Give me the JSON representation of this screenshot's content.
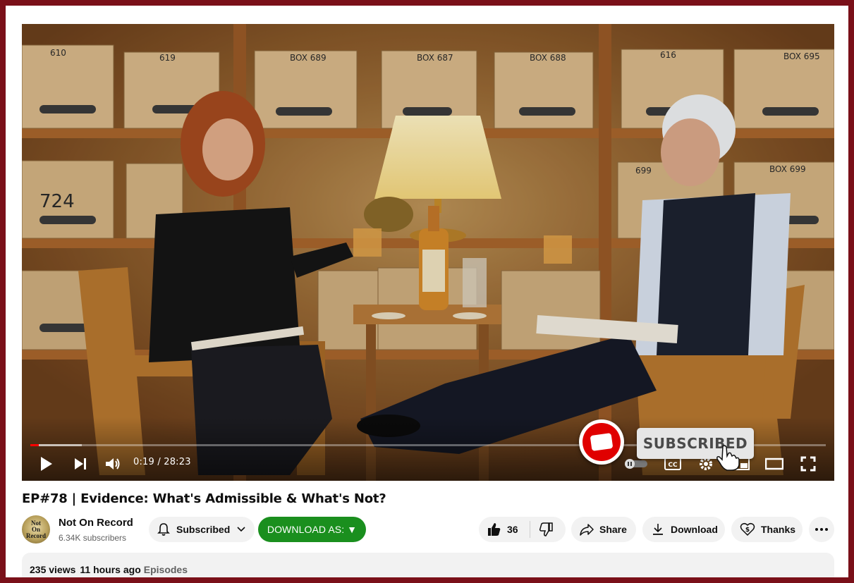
{
  "player": {
    "time_display": "0:19 / 28:23",
    "progress_fraction": 0.011,
    "buffered_fraction": 0.065,
    "overlay_subscribed_text": "SUBSCRIBED",
    "scene_box_labels": [
      "610",
      "619",
      "BOX 689",
      "BOX 687",
      "BOX 688",
      "616",
      "BOX 695",
      "724",
      "699",
      "BOX 699"
    ]
  },
  "video": {
    "title": "EP#78 | Evidence: What's Admissible & What's Not?"
  },
  "channel": {
    "avatar_text": [
      "Not",
      "On",
      "Record"
    ],
    "name": "Not On Record",
    "subscribers": "6.34K subscribers"
  },
  "actions": {
    "subscribed_label": "Subscribed",
    "download_as_label": "DOWNLOAD AS: ▼",
    "like_count": "36",
    "share_label": "Share",
    "download_label": "Download",
    "thanks_label": "Thanks"
  },
  "description": {
    "views": "235 views",
    "age": "11 hours ago",
    "tag": "Episodes"
  },
  "colors": {
    "border": "#7a1019",
    "progress": "#ff0000",
    "download_as_bg": "#1a8f1e",
    "chip_bg": "#f2f2f2"
  }
}
